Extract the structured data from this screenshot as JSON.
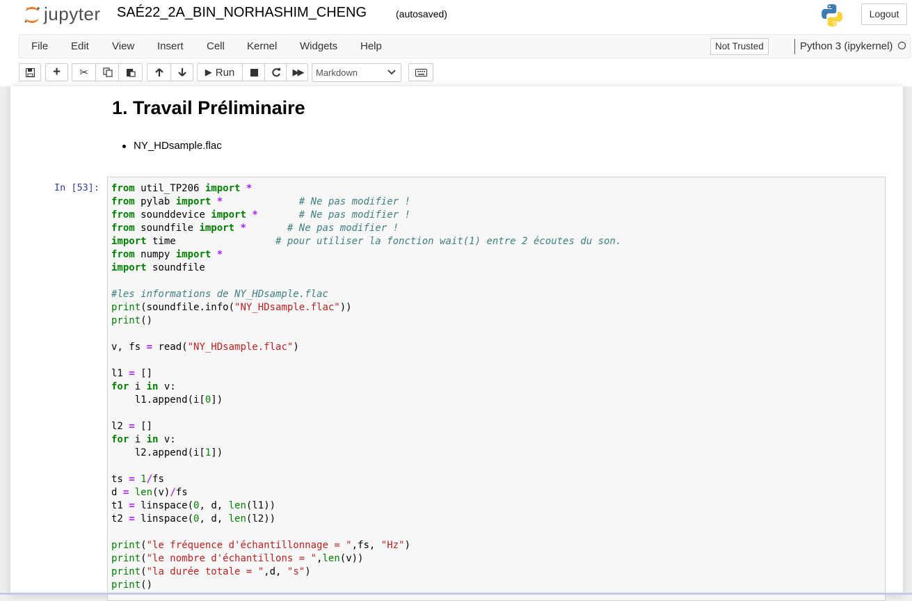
{
  "header": {
    "brand": "jupyter",
    "notebook_name": "SAÉ22_2A_BIN_NORHASHIM_CHENG",
    "autosave": "(autosaved)",
    "logout": "Logout"
  },
  "menu": [
    "File",
    "Edit",
    "View",
    "Insert",
    "Cell",
    "Kernel",
    "Widgets",
    "Help"
  ],
  "trust": "Not Trusted",
  "kernel": "Python 3 (ipykernel)",
  "toolbar": {
    "run_label": "Run",
    "cell_type": "Markdown"
  },
  "markdown": {
    "heading": "1. Travail Préliminaire",
    "list_item": "NY_HDsample.flac"
  },
  "cell": {
    "prompt": "In [53]:",
    "lines": [
      [
        [
          "k",
          "from"
        ],
        [
          "t",
          " util_TP206 "
        ],
        [
          "k",
          "import"
        ],
        [
          "t",
          " "
        ],
        [
          "o",
          "*"
        ]
      ],
      [
        [
          "k",
          "from"
        ],
        [
          "t",
          " pylab "
        ],
        [
          "k",
          "import"
        ],
        [
          "t",
          " "
        ],
        [
          "o",
          "*"
        ],
        [
          "t",
          "             "
        ],
        [
          "c",
          "# Ne pas modifier !"
        ]
      ],
      [
        [
          "k",
          "from"
        ],
        [
          "t",
          " sounddevice "
        ],
        [
          "k",
          "import"
        ],
        [
          "t",
          " "
        ],
        [
          "o",
          "*"
        ],
        [
          "t",
          "       "
        ],
        [
          "c",
          "# Ne pas modifier !"
        ]
      ],
      [
        [
          "k",
          "from"
        ],
        [
          "t",
          " soundfile "
        ],
        [
          "k",
          "import"
        ],
        [
          "t",
          " "
        ],
        [
          "o",
          "*"
        ],
        [
          "t",
          "       "
        ],
        [
          "c",
          "# Ne pas modifier !"
        ]
      ],
      [
        [
          "k",
          "import"
        ],
        [
          "t",
          " time                 "
        ],
        [
          "c",
          "# pour utiliser la fonction wait(1) entre 2 écoutes du son."
        ]
      ],
      [
        [
          "k",
          "from"
        ],
        [
          "t",
          " numpy "
        ],
        [
          "k",
          "import"
        ],
        [
          "t",
          " "
        ],
        [
          "o",
          "*"
        ]
      ],
      [
        [
          "k",
          "import"
        ],
        [
          "t",
          " soundfile"
        ]
      ],
      [],
      [
        [
          "c",
          "#les informations de NY_HDsample.flac"
        ]
      ],
      [
        [
          "b",
          "print"
        ],
        [
          "t",
          "(soundfile.info("
        ],
        [
          "s",
          "\"NY_HDsample.flac\""
        ],
        [
          "t",
          "))"
        ]
      ],
      [
        [
          "b",
          "print"
        ],
        [
          "t",
          "()"
        ]
      ],
      [],
      [
        [
          "t",
          "v, fs "
        ],
        [
          "o",
          "="
        ],
        [
          "t",
          " read("
        ],
        [
          "s",
          "\"NY_HDsample.flac\""
        ],
        [
          "t",
          ")"
        ]
      ],
      [],
      [
        [
          "t",
          "l1 "
        ],
        [
          "o",
          "="
        ],
        [
          "t",
          " []"
        ]
      ],
      [
        [
          "k",
          "for"
        ],
        [
          "t",
          " i "
        ],
        [
          "k",
          "in"
        ],
        [
          "t",
          " v:"
        ]
      ],
      [
        [
          "t",
          "    l1.append(i["
        ],
        [
          "n",
          "0"
        ],
        [
          "t",
          "])"
        ]
      ],
      [],
      [
        [
          "t",
          "l2 "
        ],
        [
          "o",
          "="
        ],
        [
          "t",
          " []"
        ]
      ],
      [
        [
          "k",
          "for"
        ],
        [
          "t",
          " i "
        ],
        [
          "k",
          "in"
        ],
        [
          "t",
          " v:"
        ]
      ],
      [
        [
          "t",
          "    l2.append(i["
        ],
        [
          "n",
          "1"
        ],
        [
          "t",
          "])"
        ]
      ],
      [],
      [
        [
          "t",
          "ts "
        ],
        [
          "o",
          "="
        ],
        [
          "t",
          " "
        ],
        [
          "n",
          "1"
        ],
        [
          "o",
          "/"
        ],
        [
          "t",
          "fs"
        ]
      ],
      [
        [
          "t",
          "d "
        ],
        [
          "o",
          "="
        ],
        [
          "t",
          " "
        ],
        [
          "b",
          "len"
        ],
        [
          "t",
          "(v)"
        ],
        [
          "o",
          "/"
        ],
        [
          "t",
          "fs"
        ]
      ],
      [
        [
          "t",
          "t1 "
        ],
        [
          "o",
          "="
        ],
        [
          "t",
          " linspace("
        ],
        [
          "n",
          "0"
        ],
        [
          "t",
          ", d, "
        ],
        [
          "b",
          "len"
        ],
        [
          "t",
          "(l1))"
        ]
      ],
      [
        [
          "t",
          "t2 "
        ],
        [
          "o",
          "="
        ],
        [
          "t",
          " linspace("
        ],
        [
          "n",
          "0"
        ],
        [
          "t",
          ", d, "
        ],
        [
          "b",
          "len"
        ],
        [
          "t",
          "(l2))"
        ]
      ],
      [],
      [
        [
          "b",
          "print"
        ],
        [
          "t",
          "("
        ],
        [
          "s",
          "\"le fréquence d'échantillonnage = \""
        ],
        [
          "t",
          ",fs, "
        ],
        [
          "s",
          "\"Hz\""
        ],
        [
          "t",
          ")"
        ]
      ],
      [
        [
          "b",
          "print"
        ],
        [
          "t",
          "("
        ],
        [
          "s",
          "\"le nombre d'échantillons = \""
        ],
        [
          "t",
          ","
        ],
        [
          "b",
          "len"
        ],
        [
          "t",
          "(v))"
        ]
      ],
      [
        [
          "b",
          "print"
        ],
        [
          "t",
          "("
        ],
        [
          "s",
          "\"la durée totale = \""
        ],
        [
          "t",
          ",d, "
        ],
        [
          "s",
          "\"s\""
        ],
        [
          "t",
          ")"
        ]
      ],
      [
        [
          "b",
          "print"
        ],
        [
          "t",
          "()"
        ]
      ]
    ]
  }
}
